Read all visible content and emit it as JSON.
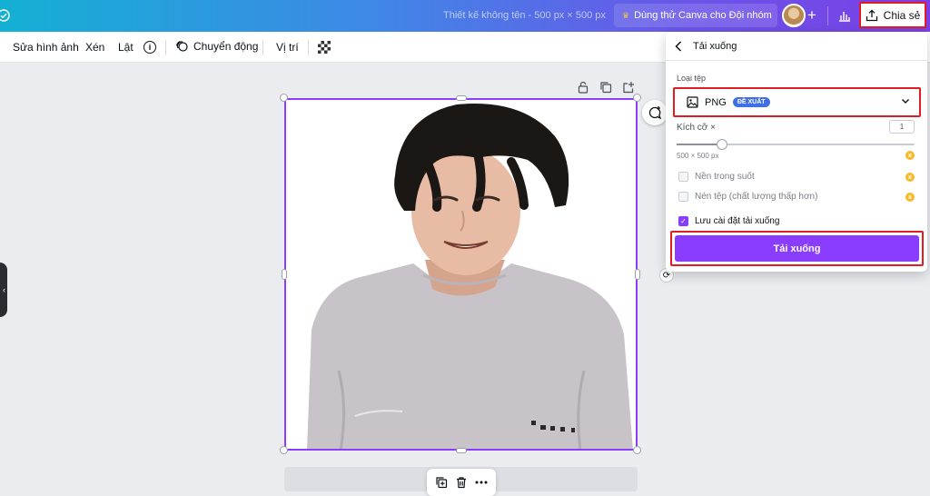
{
  "topbar": {
    "design_title": "Thiết kế không tên - 500 px × 500 px",
    "try_team": "Dùng thử Canva cho Đội nhóm",
    "share": "Chia sẻ"
  },
  "toolbar": {
    "edit_image": "Sửa hình ảnh",
    "crop": "Xén",
    "flip": "Lật",
    "info": "i",
    "animate": "Chuyển động",
    "position": "Vị trí"
  },
  "download_panel": {
    "title": "Tải xuống",
    "file_type_label": "Loại tệp",
    "file_type": "PNG",
    "recommended_badge": "ĐỀ XUẤT",
    "size_label": "Kích cỡ ×",
    "size_value": "1",
    "size_slider": 0.19,
    "dimensions": "500 × 500 px",
    "transparent_bg": "Nền trong suốt",
    "compress": "Nén tệp (chất lượng thấp hơn)",
    "save_settings": "Lưu cài đặt tải xuống",
    "save_settings_checked": true,
    "download_button": "Tải xuống"
  },
  "colors": {
    "accent": "#8b3dff",
    "highlight": "#e31b23",
    "badge": "#3f6fe6",
    "pro": "#f7b928"
  }
}
